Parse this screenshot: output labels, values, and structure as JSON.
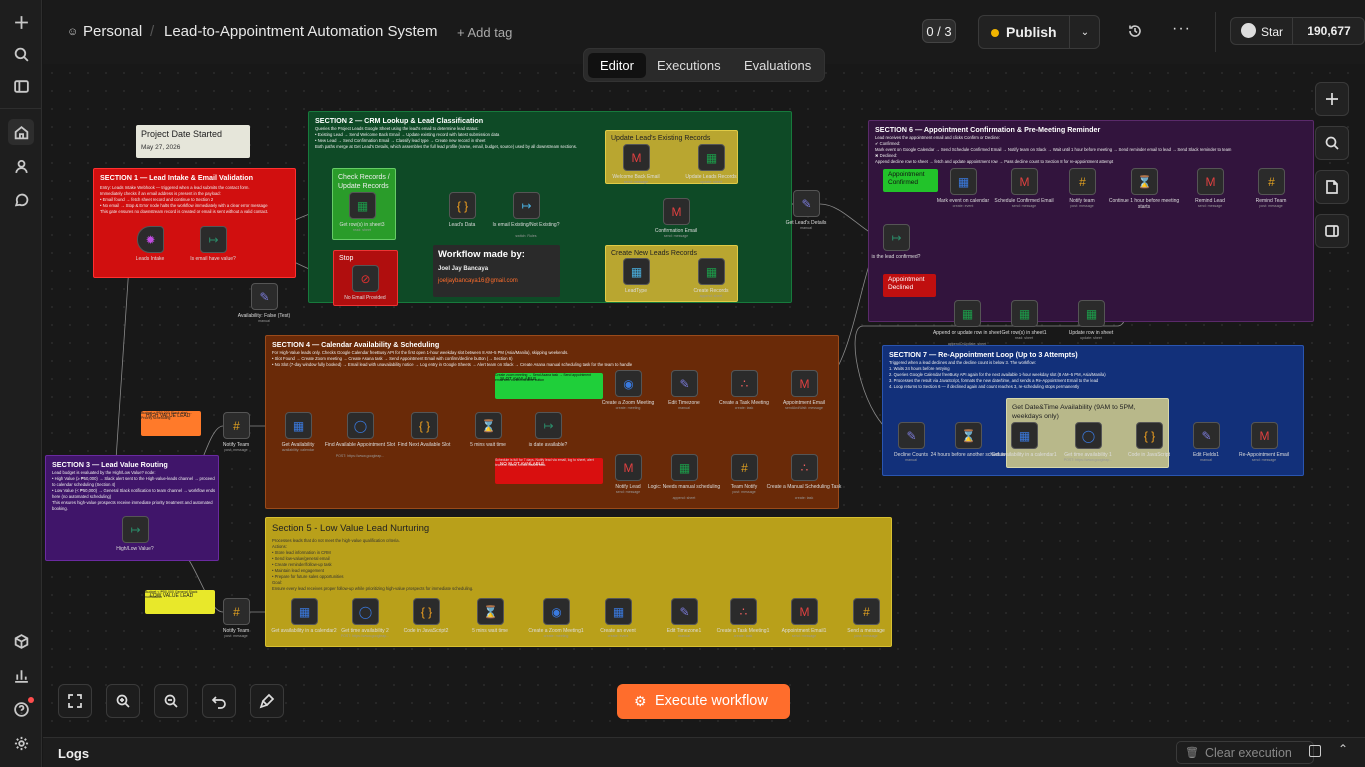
{
  "header": {
    "owner": "Personal",
    "title": "Lead-to-Appointment Automation System",
    "add_tag": "+ Add tag",
    "counter": "0 / 3",
    "publish": "Publish",
    "star": "Star",
    "star_count": "190,677"
  },
  "tabs": [
    "Editor",
    "Executions",
    "Evaluations"
  ],
  "canvas": {
    "project_note": {
      "title": "Project Date Started",
      "date": "May 27, 2026"
    },
    "s1": {
      "title": "SECTION 1 — Lead Intake & Email Validation",
      "body": "Entry: Leads Intake Webhook — triggered when a lead submits the contact form.\nImmediately checks if an email address is present in the payload:\n• Email found → fetch sheet record and continue to Section 2\n• No email → Stop & Error node halts the workflow immediately with a clear error message\nThis gate ensures no downstream record is created or email is sent without a valid contact."
    },
    "s2": {
      "title": "SECTION 2 — CRM Lookup & Lead Classification",
      "body": "Queries the Project Leads Google Sheet using the lead's email to determine lead status:\n• Existing Lead → Send Welcome Back Email → Update existing record with latest submission data\n• New Lead → Send Confirmation Email → Classify lead type → Create new record in sheet\nBoth paths merge at Get Lead's Details, which assembles the full lead profile (name, email, budget, source) used by all downstream sections."
    },
    "s2_notes": {
      "check": "Check Records / Update Records",
      "stop": "Stop",
      "existing": "Update Lead's Existing Records",
      "create": "Create New Leads Records"
    },
    "credit": {
      "title": "Workflow made by:",
      "name": "Joel Jay Bancaya",
      "email": "joeljaybancaya16@gmail.com"
    },
    "s3": {
      "title": "SECTION 3 — Lead Value Routing",
      "body": "Lead budget is evaluated by the High/Low Value? node:\n• High Value (≥ ₱50,000) → Slack alert sent to the High-value-leads channel → proceed to calendar scheduling (Section 4)\n• Low Value (< ₱50,000) → General Slack notification to team channel → workflow ends here (no automated scheduling)\nThis ensures high-value prospects receive immediate priority treatment and automated booking."
    },
    "high_note": {
      "title": "HIGH VALUE LEAD",
      "body": "Budget ≥ ₱50,000\nSlack alert → Priority scheduling"
    },
    "low_note": {
      "title": "LOW VALUE LEAD",
      "body": "Budget < ₱50,000\nGeneral Slack notification"
    },
    "s4": {
      "title": "SECTION 4 — Calendar Availability & Scheduling",
      "body": "For High-Value leads only. Checks Google Calendar freeBusy API for the first open 1-hour weekday slot between 8 AM–5 PM (Asia/Manila), skipping weekends.\n• Slot Found → Create Zoom meeting → Create Asana task → Send Appointment Email with confirm/decline button (→ Section 6)\n• No Slot (7-day window fully booked) → Email lead with unavailability notice → Log entry in Google Sheets → Alert team on Slack → Create Asana manual scheduling task for the team to handle"
    },
    "slot_avail": {
      "title": "SLOT AVAILABLE",
      "body": "Create zoom meeting → Send Asana task → Send appointment email with confirm/decline button"
    },
    "no_slot": {
      "title": "NO SLOT AVAILABLE",
      "body": "Schedule is full for 7 days. Notify lead via email, log to sheet, alert team on Slack, create Asana task."
    },
    "s5": {
      "title": "Section 5 - Low Value Lead Nurturing",
      "body": "Processes leads that do not meet the high-value qualification criteria.\nActions:\n• Store lead information in CRM\n• Send low-value/general email\n• Create reminder/follow-up task\n• Maintain lead engagement\n• Prepare for future sales opportunities\nGoal:\nEnsure every lead receives proper follow-up while prioritizing high-value prospects for immediate scheduling."
    },
    "s6": {
      "title": "SECTION 6 — Appointment Confirmation & Pre-Meeting Reminder",
      "body": "Lead receives the appointment email and clicks Confirm or Decline:\n✔ Confirmed:\nMark event on Google Calendar → Send Schedule Confirmed Email → Notify team on Slack → Wait until 1 hour before meeting → Send reminder email to lead → Send Slack reminder to team\n✖ Declined:\nAppend decline row to sheet → fetch and update appointment row → Pass decline count to Section 8 for re-appointment attempt"
    },
    "s6_notes": {
      "confirmed": "Appointment Confirmed",
      "declined": "Appointment Declined"
    },
    "s7": {
      "title": "SECTION 7 — Re-Appointment Loop (Up to 3 Attempts)",
      "body": "Triggered when a lead declines and the decline count is below 3. The workflow:\n1. Waits 24 hours before retrying\n2. Queries Google Calendar freeBusy API again for the next available 1-hour weekday slot (8 AM–5 PM, Asia/Manila)\n3. Processes the result via JavaScript, formats the new date/time, and sends a Re-Appointment Email to the lead\n4. Loop returns to Section 6 — if declined again and count reaches 3, re-scheduling stops permanently"
    },
    "s7_note": "Get Date&Time Availability (9AM to 5PM, weekdays only)",
    "nodes": {
      "leads_intake": [
        "Leads Intake",
        ""
      ],
      "email_check": [
        "Is email have value?",
        ""
      ],
      "availability_false": [
        "Availability: False (Test)",
        "manual"
      ],
      "get_rows": [
        "Get row(s) in sheet3",
        "read: sheet"
      ],
      "no_email": [
        "No Email Provided",
        ""
      ],
      "leads_data": [
        "Lead's Data",
        ""
      ],
      "is_existing": [
        "Is email Existing/Not Existing?",
        "switch: Rules"
      ],
      "welcome_email": [
        "Welcome Back Email",
        "send: message"
      ],
      "update_leads": [
        "Update Leads Records",
        "update: sheet"
      ],
      "confirmation_email": [
        "Confirmation Email",
        "send: message"
      ],
      "lead_type": [
        "LeadType",
        ""
      ],
      "create_records": [
        "Create Records",
        "append: sheet"
      ],
      "get_details": [
        "Get Lead's Details",
        "manual"
      ],
      "notify_team_h": [
        "Notify Team",
        "post: message"
      ],
      "high_low": [
        "High/Low Value?",
        ""
      ],
      "notify_team_l": [
        "Notify Team",
        "post: message"
      ],
      "get_avail": [
        "Get Availability",
        "availability: calendar"
      ],
      "find_slot": [
        "Find Available Appointment Slot",
        "POST: https://www.googleap..."
      ],
      "find_next": [
        "Find Next Available Slot",
        ""
      ],
      "wait5": [
        "5 mins wait time",
        ""
      ],
      "is_date": [
        "is date available?",
        ""
      ],
      "zoom": [
        "Create a Zoom Meeting",
        "create: meeting"
      ],
      "edit_tz": [
        "Edit Timezone",
        "manual"
      ],
      "asana": [
        "Create a Task Meeting",
        "create: task"
      ],
      "appt_email": [
        "Appointment Email",
        "sendAndWait: message"
      ],
      "notify_lead": [
        "Notify Lead",
        "send: message"
      ],
      "logic_manual": [
        "Logic: Needs manual scheduling",
        "append: sheet"
      ],
      "team_notify": [
        "Team Notify",
        "post: message"
      ],
      "manual_task": [
        "Create a Manual Scheduling Task",
        "create: task"
      ],
      "c2": [
        "Get availability in a calendar2",
        ""
      ],
      "t2": [
        "Get time availability 2",
        "POST: https://www.googleap..."
      ],
      "js2": [
        "Code in JavaScript2",
        ""
      ],
      "w2": [
        "5 mins wait time",
        ""
      ],
      "zm2": [
        "Create a Zoom Meeting1",
        "create: meeting"
      ],
      "ev2": [
        "Create an event",
        "create: event"
      ],
      "tz2": [
        "Edit Timezone1",
        "manual"
      ],
      "as2": [
        "Create a Task Meeting1",
        "create: task"
      ],
      "ae2": [
        "Appointment Email1",
        "send: message"
      ],
      "sm2": [
        "Send a message",
        "post: message"
      ],
      "is_confirmed": [
        "is the lead confirmed?",
        ""
      ],
      "mark_event": [
        "Mark event on calendar",
        "create: event"
      ],
      "sched_email": [
        "Schedule Confirmed Email",
        "send: message"
      ],
      "notify6": [
        "Notify team",
        "post: message"
      ],
      "continue": [
        "Continue 1 hour before meeting starts",
        ""
      ],
      "remind_lead": [
        "Remind Lead",
        "send: message"
      ],
      "remind_team": [
        "Remind Team",
        "post: message"
      ],
      "append_row": [
        "Append or update row in sheet",
        "appendOrUpdate: sheet"
      ],
      "get_row1": [
        "Get row(s) in sheet1",
        "read: sheet"
      ],
      "update_row": [
        "Update row in sheet",
        "update: sheet"
      ],
      "decline": [
        "Decline Counts",
        "manual"
      ],
      "wait24": [
        "24 hours before another schedule",
        ""
      ],
      "cal1": [
        "Get availability in a calendar1",
        ""
      ],
      "time1": [
        "Get time availability 1",
        "POST: https://www.googleap..."
      ],
      "js1": [
        "Code in JavaScript",
        ""
      ],
      "edit1": [
        "Edit Fields1",
        "manual"
      ],
      "reappt": [
        "Re-Appointment Email",
        "send: message"
      ]
    }
  },
  "controls": {
    "execute": "Execute workflow",
    "logs": "Logs",
    "clear": "Clear execution"
  },
  "colors": {
    "accent": "#ff6d2c",
    "s1": "#d10f0f",
    "s2": "#0e4a26",
    "s3": "#40156a",
    "s4": "#6a2a08",
    "s5": "#b9a01a",
    "s6": "#32143d",
    "s7": "#12307a"
  }
}
